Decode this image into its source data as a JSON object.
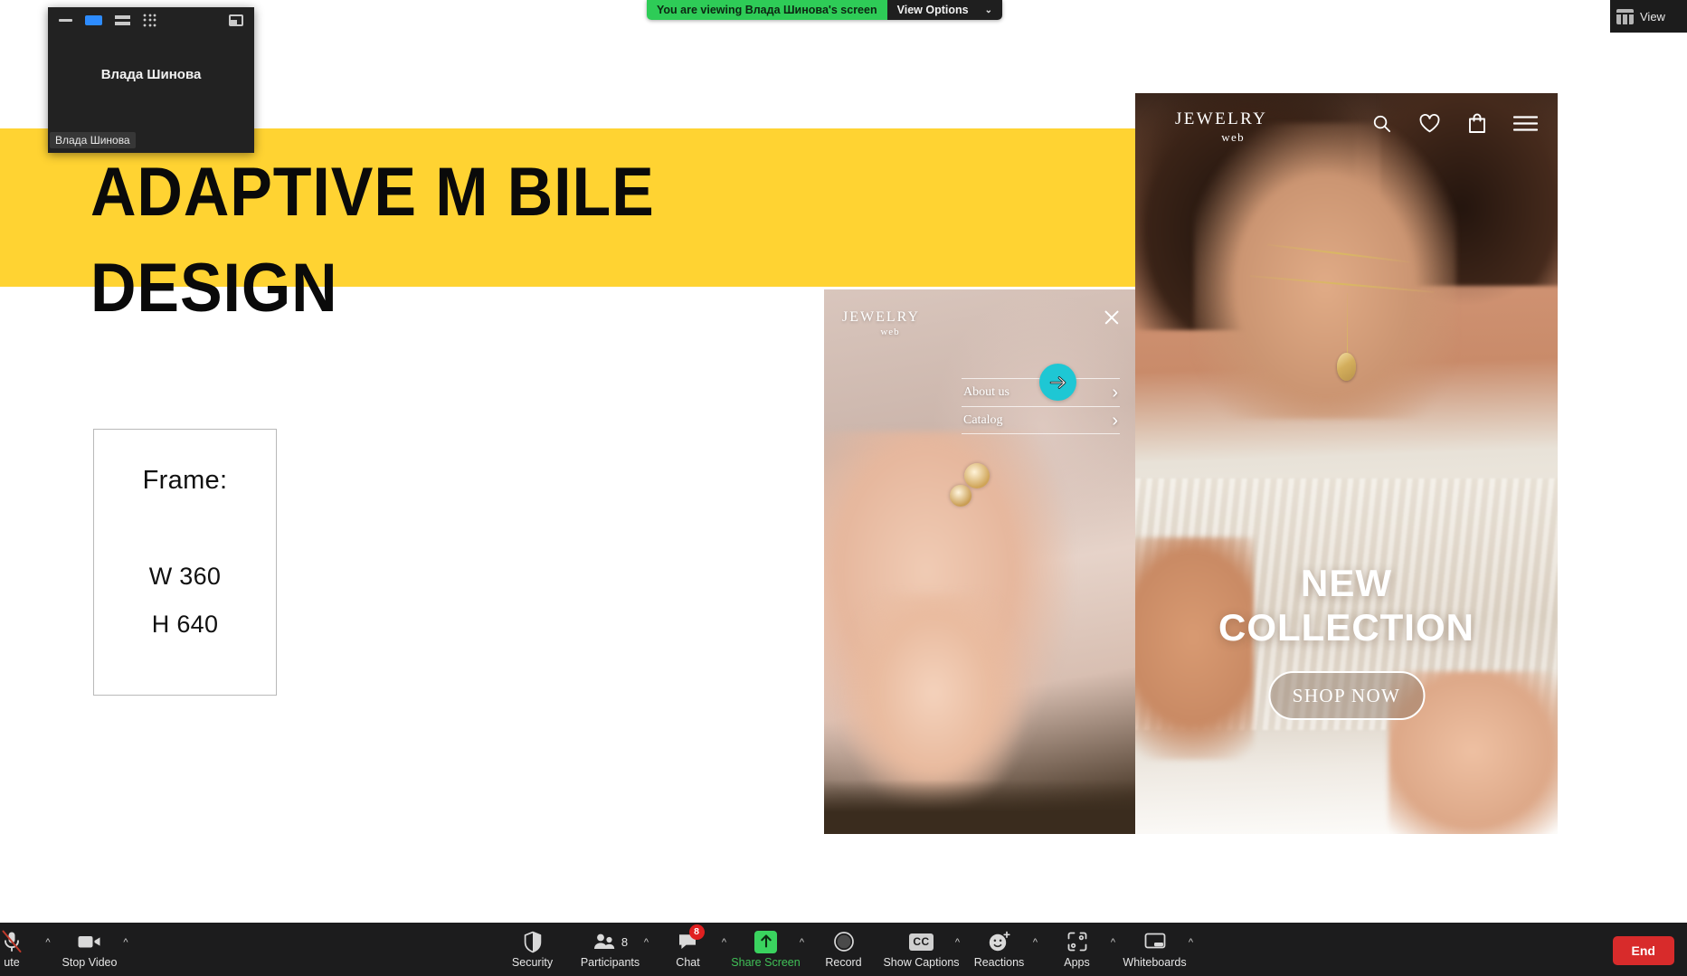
{
  "share_banner": {
    "message": "You are viewing Влада Шинова's screen",
    "view_options_label": "View Options",
    "caret": "⌄",
    "green": "#2ecc57"
  },
  "view_button": {
    "label": "View",
    "icon": "gallery-view-icon"
  },
  "thumbnail_window": {
    "participant_name": "Влада Шинова",
    "name_label": "Влада Шинова",
    "controls": [
      {
        "name": "minimize",
        "icon": "minimize-icon"
      },
      {
        "name": "speaker-view",
        "icon": "speaker-view-icon",
        "active": true
      },
      {
        "name": "split-view",
        "icon": "split-view-icon"
      },
      {
        "name": "gallery-view",
        "icon": "grid-view-icon"
      },
      {
        "name": "popout",
        "icon": "popout-icon"
      }
    ],
    "active_color": "#2d8cff"
  },
  "shared_screen": {
    "hero_title": "ADAPTIVE M BILE\nDESIGN",
    "band_color": "#ffd332",
    "frame_card": {
      "title": "Frame:",
      "width_label": "W 360",
      "height_label": "H 640"
    },
    "phone_menu": {
      "logo_top": "JEWELRY",
      "logo_bottom": "web",
      "close_icon": "close-icon",
      "items": [
        {
          "label": "About us",
          "chevron": "›"
        },
        {
          "label": "Catalog",
          "chevron": "›"
        }
      ],
      "cursor_color": "#1ec7d4"
    },
    "phone_hero": {
      "logo_top": "JEWELRY",
      "logo_bottom": "web",
      "icons": [
        "search-icon",
        "heart-icon",
        "shopping-bag-icon",
        "hamburger-menu-icon"
      ],
      "headline": "NEW\nCOLLECTION",
      "cta_label": "SHOP NOW"
    }
  },
  "toolbar": {
    "left": [
      {
        "label": "ute",
        "icon": "microphone-muted-icon",
        "name": "unmute",
        "caret": "^"
      },
      {
        "label": "Stop Video",
        "icon": "video-camera-icon",
        "name": "stop-video",
        "caret": "^"
      }
    ],
    "center": [
      {
        "label": "Security",
        "icon": "shield-icon",
        "name": "security"
      },
      {
        "label": "Participants",
        "icon": "participants-icon",
        "name": "participants",
        "count": "8",
        "caret": "^"
      },
      {
        "label": "Chat",
        "icon": "chat-bubble-icon",
        "name": "chat",
        "badge": "8",
        "caret": "^"
      },
      {
        "label": "Share Screen",
        "icon": "share-screen-icon",
        "name": "share-screen",
        "green": true,
        "caret": "^"
      },
      {
        "label": "Record",
        "icon": "record-icon",
        "name": "record"
      },
      {
        "label": "Show Captions",
        "icon": "closed-captions-icon",
        "name": "show-captions",
        "cc_text": "CC",
        "caret": "^"
      },
      {
        "label": "Reactions",
        "icon": "reactions-icon",
        "name": "reactions",
        "caret": "^"
      },
      {
        "label": "Apps",
        "icon": "apps-icon",
        "name": "apps",
        "caret": "^"
      },
      {
        "label": "Whiteboards",
        "icon": "whiteboard-icon",
        "name": "whiteboards",
        "caret": "^"
      }
    ],
    "end_button": {
      "label": "End",
      "color": "#d82b2b"
    }
  }
}
